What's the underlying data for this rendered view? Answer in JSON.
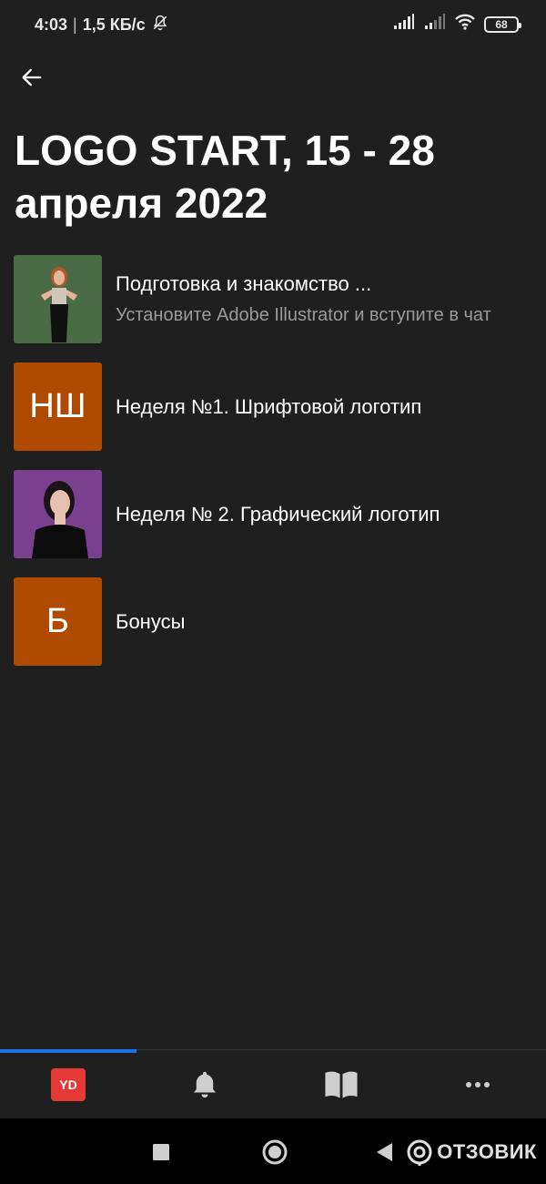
{
  "status_bar": {
    "time": "4:03",
    "separator": "|",
    "speed": "1,5 КБ/с",
    "battery": "68"
  },
  "header": {
    "title": "LOGO START,  15 - 28\nапреля 2022"
  },
  "lessons": [
    {
      "thumb_type": "photo",
      "title": "Подготовка и знакомство ...",
      "subtitle": "Установите Adobe Illustrator и вступите в чат"
    },
    {
      "thumb_type": "letters",
      "thumb_text": "НШ",
      "title": "Неделя №1. Шрифтовой логотип"
    },
    {
      "thumb_type": "photo",
      "title": "Неделя № 2. Графический логотип"
    },
    {
      "thumb_type": "letters",
      "thumb_text": "Б",
      "title": "Бонусы"
    }
  ],
  "tab_bar": {
    "tabs": [
      {
        "icon": "yd-logo-icon",
        "badge_text": "YD",
        "active": true
      },
      {
        "icon": "bell-icon"
      },
      {
        "icon": "book-icon"
      },
      {
        "icon": "more-icon"
      }
    ]
  },
  "watermark": {
    "text": "ОТЗОВИК"
  },
  "colors": {
    "background": "#1f1f1f",
    "thumb_orange": "#b04a00",
    "accent_blue": "#1a73e8",
    "badge_red": "#e53935"
  }
}
